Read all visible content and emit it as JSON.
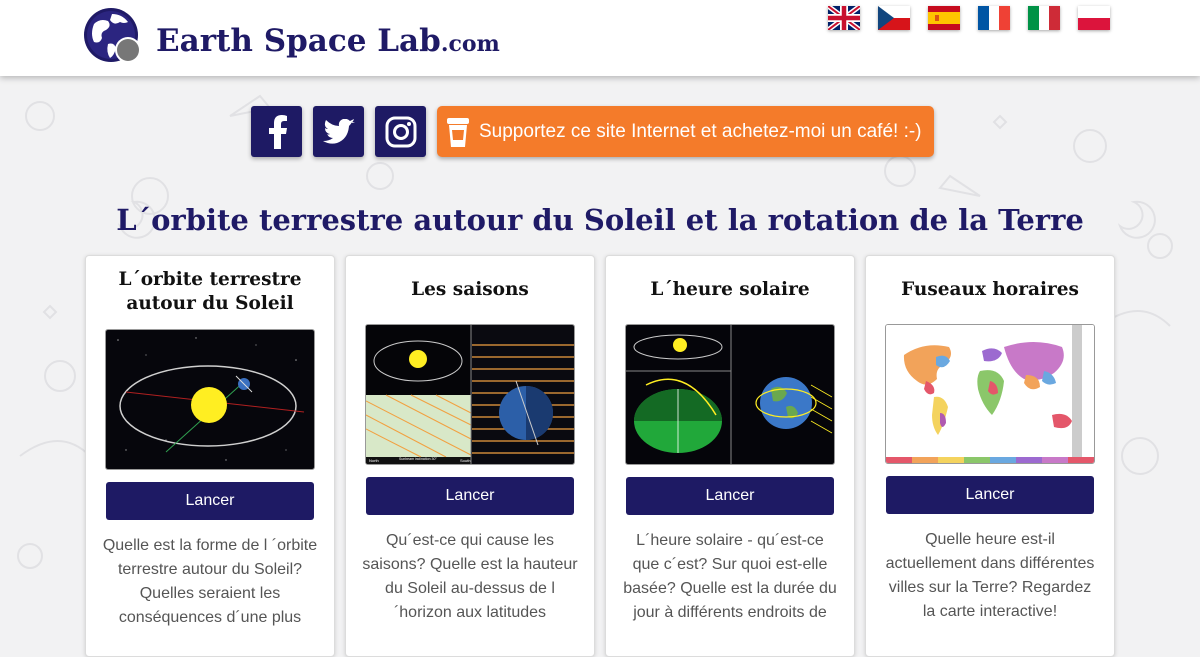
{
  "header": {
    "logo_name": "Earth Space Lab",
    "logo_suffix": ".com",
    "languages": [
      {
        "code": "en",
        "icon": "uk-flag-icon"
      },
      {
        "code": "cs",
        "icon": "czech-flag-icon"
      },
      {
        "code": "es",
        "icon": "spain-flag-icon"
      },
      {
        "code": "fr",
        "icon": "france-flag-icon",
        "active": true
      },
      {
        "code": "it",
        "icon": "italy-flag-icon"
      },
      {
        "code": "pl",
        "icon": "poland-flag-icon"
      }
    ]
  },
  "social": {
    "icons": [
      "facebook-icon",
      "twitter-icon",
      "instagram-icon"
    ],
    "coffee_label": "Supportez ce site Internet et achetez-moi un café! :-)"
  },
  "page_title": "L´orbite terrestre autour du Soleil et la rotation de la Terre",
  "cards": [
    {
      "title": "L´orbite terrestre autour du Soleil",
      "button": "Lancer",
      "description": "Quelle est la forme de l ´orbite terrestre autour du Soleil? Quelles seraient les conséquences d´une plus"
    },
    {
      "title": "Les saisons",
      "button": "Lancer",
      "description": "Qu´est-ce qui cause les saisons? Quelle est la hauteur du Soleil au-dessus de l´horizon aux latitudes",
      "thumb_labels": {
        "north": "North",
        "south": "South",
        "inclination": "Sunbeam inclination 30°"
      }
    },
    {
      "title": "L´heure solaire",
      "button": "Lancer",
      "description": "L´heure solaire - qu´est-ce que c´est? Sur quoi est-elle basée? Quelle est la durée du jour à différents endroits de"
    },
    {
      "title": "Fuseaux horaires",
      "button": "Lancer",
      "description": "Quelle heure est-il actuellement dans différentes villes sur la Terre? Regardez la carte interactive!"
    }
  ],
  "colors": {
    "brand_navy": "#1e1a64",
    "coffee_orange": "#f47b2a",
    "background": "#f2f2f3"
  }
}
